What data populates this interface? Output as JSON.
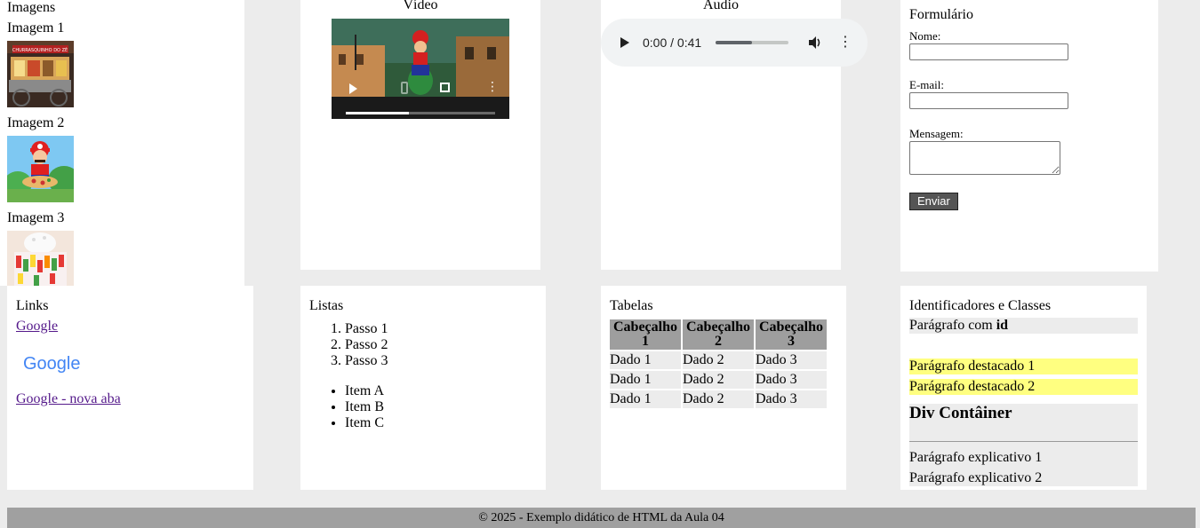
{
  "images": {
    "title": "Imagens",
    "items": [
      {
        "label": "Imagem 1",
        "sign": "CHURRASQUINHO DO ZÉ"
      },
      {
        "label": "Imagem 2"
      },
      {
        "label": "Imagem 3"
      }
    ]
  },
  "video": {
    "title": "Vídeo",
    "progress": 0.42
  },
  "audio": {
    "title": "Áudio",
    "time": "0:00 / 0:41",
    "progress": 0.5
  },
  "form": {
    "title": "Formulário",
    "name_label": "Nome:",
    "email_label": "E-mail:",
    "message_label": "Mensagem:",
    "submit_label": "Enviar"
  },
  "links": {
    "title": "Links",
    "google_link": "Google",
    "google_logo": "Google",
    "google_new_tab": "Google - nova aba"
  },
  "lists": {
    "title": "Listas",
    "ordered": [
      "Passo 1",
      "Passo 2",
      "Passo 3"
    ],
    "unordered": [
      "Item A",
      "Item B",
      "Item C"
    ]
  },
  "tables": {
    "title": "Tabelas",
    "headers": [
      "Cabeçalho 1",
      "Cabeçalho 2",
      "Cabeçalho 3"
    ],
    "rows": [
      [
        "Dado 1",
        "Dado 2",
        "Dado 3"
      ],
      [
        "Dado 1",
        "Dado 2",
        "Dado 3"
      ],
      [
        "Dado 1",
        "Dado 2",
        "Dado 3"
      ]
    ]
  },
  "ids": {
    "title": "Identificadores e Classes",
    "p_id_prefix": "Parágrafo com ",
    "p_id_bold": "id",
    "highlight_1": "Parágrafo destacado 1",
    "highlight_2": "Parágrafo destacado 2",
    "div_title": "Div Contâiner",
    "explain_1": "Parágrafo explicativo 1",
    "explain_2": "Parágrafo explicativo 2"
  },
  "footer": {
    "text": "© 2025 - Exemplo didático de HTML da Aula 04"
  }
}
